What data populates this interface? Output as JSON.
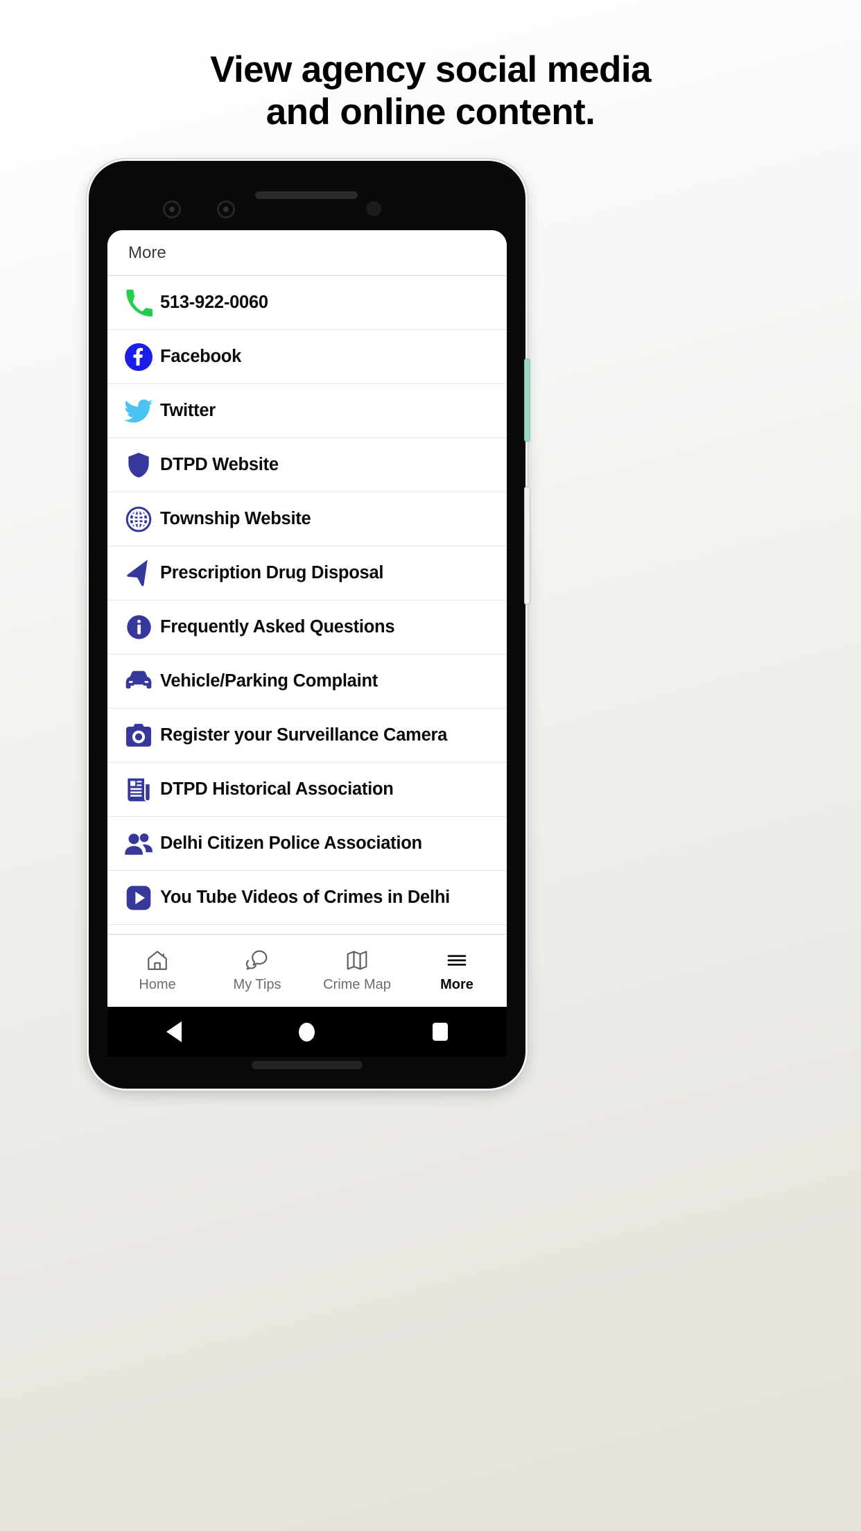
{
  "headline": {
    "line1": "View agency social media",
    "line2": "and online content."
  },
  "colors": {
    "brand_navy": "#36399B",
    "facebook_blue": "#1D1DE8",
    "twitter_blue": "#4AC4F3",
    "phone_green": "#25CE4A",
    "active_tab": "#0A0A0A",
    "inactive_tab": "#6D6D6D",
    "divider": "#E4E4E4"
  },
  "phone": {
    "hardware": {
      "power_button": "power-button",
      "volume_button": "volume-rocker",
      "front_camera_1": "front-camera",
      "front_camera_2": "front-camera-secondary",
      "earpiece": "earpiece-speaker",
      "proximity_sensor": "proximity-sensor",
      "bottom_speaker": "bottom-speaker"
    }
  },
  "appbar": {
    "title": "More"
  },
  "menu": {
    "items": [
      {
        "label": "513-922-0060",
        "icon": "phone-icon"
      },
      {
        "label": "Facebook",
        "icon": "facebook-icon"
      },
      {
        "label": "Twitter",
        "icon": "twitter-icon"
      },
      {
        "label": "DTPD Website",
        "icon": "shield-icon"
      },
      {
        "label": "Township Website",
        "icon": "globe-icon"
      },
      {
        "label": "Prescription Drug Disposal",
        "icon": "navigation-arrow-icon"
      },
      {
        "label": "Frequently Asked Questions",
        "icon": "info-circle-icon"
      },
      {
        "label": "Vehicle/Parking Complaint",
        "icon": "car-icon"
      },
      {
        "label": "Register your Surveillance Camera",
        "icon": "camera-icon"
      },
      {
        "label": "DTPD Historical Association",
        "icon": "newspaper-icon"
      },
      {
        "label": "Delhi Citizen Police Association",
        "icon": "people-icon"
      },
      {
        "label": "You Tube Videos of Crimes in Delhi",
        "icon": "play-button-icon"
      }
    ]
  },
  "tabbar": {
    "tabs": [
      {
        "label": "Home",
        "icon": "house-icon",
        "active": false
      },
      {
        "label": "My Tips",
        "icon": "chat-bubbles-icon",
        "active": false
      },
      {
        "label": "Crime Map",
        "icon": "map-icon",
        "active": false
      },
      {
        "label": "More",
        "icon": "hamburger-icon",
        "active": true
      }
    ]
  },
  "android_navbar": {
    "back": "back-triangle-icon",
    "home": "home-circle-icon",
    "recents": "recents-square-icon"
  }
}
